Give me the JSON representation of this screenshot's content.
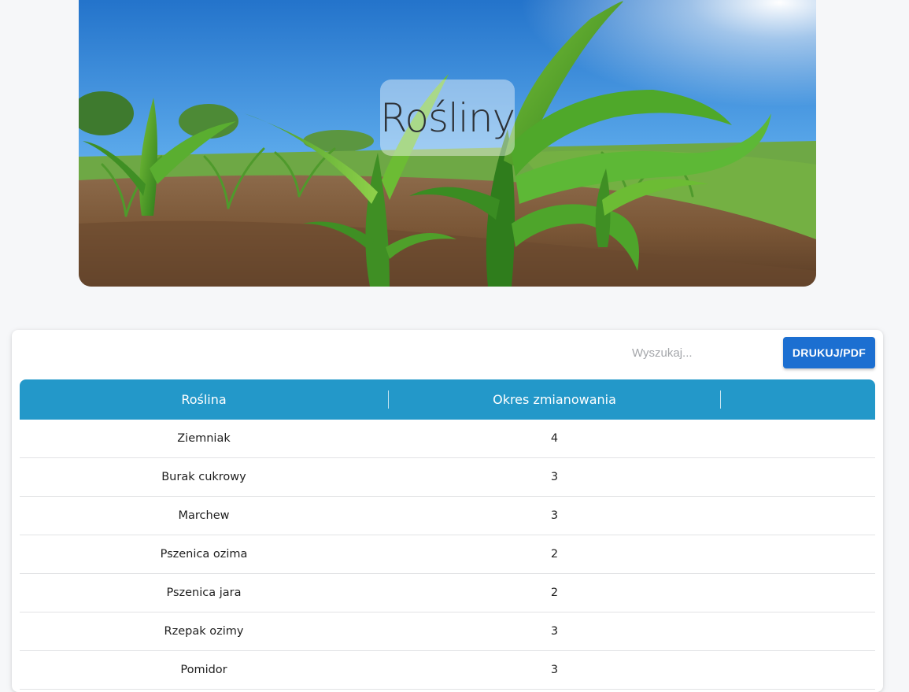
{
  "hero": {
    "title": "Rośliny"
  },
  "toolbar": {
    "search_placeholder": "Wyszukaj...",
    "print_label": "DRUKUJ/PDF"
  },
  "table": {
    "headers": [
      "Roślina",
      "Okres zmianowania",
      ""
    ],
    "rows": [
      {
        "plant": "Ziemniak",
        "period": "4"
      },
      {
        "plant": "Burak cukrowy",
        "period": "3"
      },
      {
        "plant": "Marchew",
        "period": "3"
      },
      {
        "plant": "Pszenica ozima",
        "period": "2"
      },
      {
        "plant": "Pszenica jara",
        "period": "2"
      },
      {
        "plant": "Rzepak ozimy",
        "period": "3"
      },
      {
        "plant": "Pomidor",
        "period": "3"
      }
    ]
  },
  "colors": {
    "header": "#2398c9",
    "button": "#1c6fd1",
    "background": "#f6f7f9"
  }
}
